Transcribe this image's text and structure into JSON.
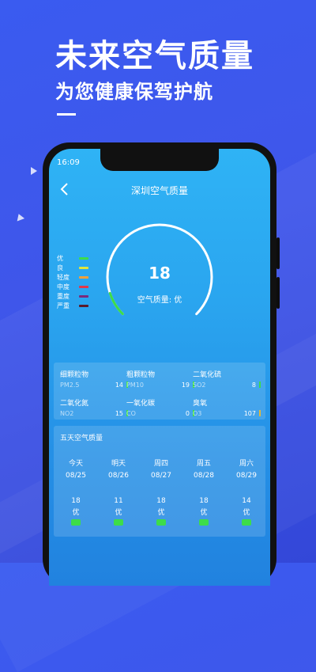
{
  "promo": {
    "title": "未来空气质量",
    "subtitle": "为您健康保驾护航"
  },
  "status_bar": {
    "time": "16:09"
  },
  "nav": {
    "back_icon": "chevron-left-icon",
    "title": "深圳空气质量"
  },
  "gauge": {
    "value": "18",
    "label": "空气质量: 优",
    "level_fraction": 0.1,
    "track_color": "#ffffff",
    "level_color": "#3ddc4a"
  },
  "legend": [
    {
      "label": "优",
      "color": "#3ddc4a"
    },
    {
      "label": "良",
      "color": "#e0e63c"
    },
    {
      "label": "轻度",
      "color": "#f2a13a"
    },
    {
      "label": "中度",
      "color": "#e2384a"
    },
    {
      "label": "重度",
      "color": "#7a2a7c"
    },
    {
      "label": "严重",
      "color": "#5a1a2a"
    }
  ],
  "pollutants": [
    {
      "name": "细颗粒物",
      "code": "PM2.5",
      "value": "14",
      "color": "#3ddc4a"
    },
    {
      "name": "粗颗粒物",
      "code": "PM10",
      "value": "19",
      "color": "#3ddc4a"
    },
    {
      "name": "二氧化硫",
      "code": "SO2",
      "value": "8",
      "color": "#3ddc4a"
    },
    {
      "name": "二氧化氮",
      "code": "NO2",
      "value": "15",
      "color": "#3ddc4a"
    },
    {
      "name": "一氧化碳",
      "code": "CO",
      "value": "0",
      "color": "#3ddc4a"
    },
    {
      "name": "臭氧",
      "code": "O3",
      "value": "107",
      "color": "#e0b83c"
    }
  ],
  "forecast": {
    "title": "五天空气质量",
    "days": [
      {
        "day": "今天",
        "date": "08/25",
        "value": "18",
        "level": "优",
        "color": "#3ddc4a"
      },
      {
        "day": "明天",
        "date": "08/26",
        "value": "11",
        "level": "优",
        "color": "#3ddc4a"
      },
      {
        "day": "周四",
        "date": "08/27",
        "value": "18",
        "level": "优",
        "color": "#3ddc4a"
      },
      {
        "day": "周五",
        "date": "08/28",
        "value": "18",
        "level": "优",
        "color": "#3ddc4a"
      },
      {
        "day": "周六",
        "date": "08/29",
        "value": "14",
        "level": "优",
        "color": "#3ddc4a"
      }
    ]
  }
}
